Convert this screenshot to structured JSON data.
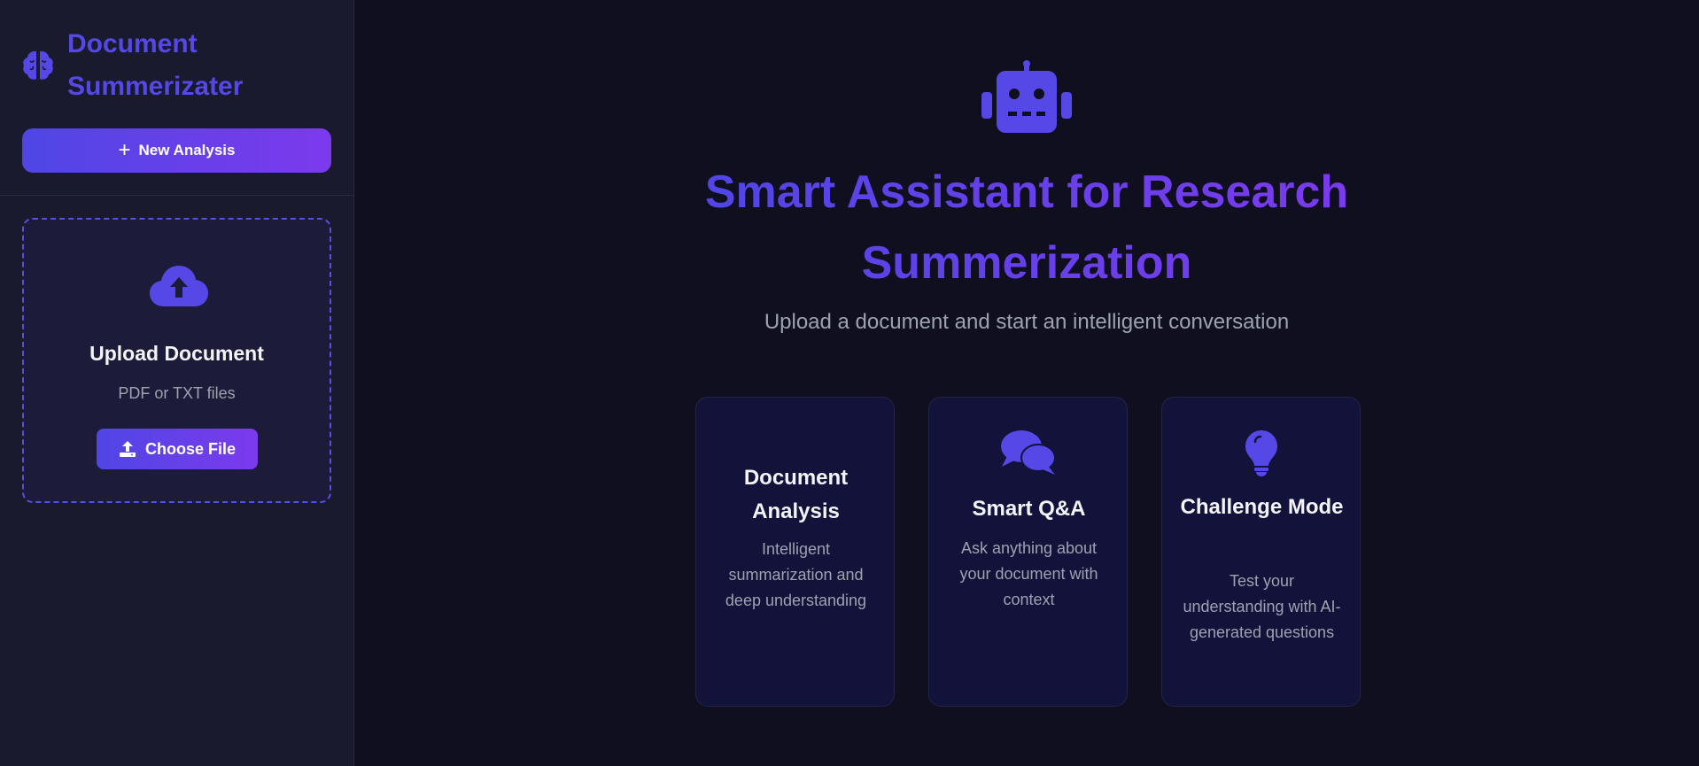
{
  "sidebar": {
    "brand_title": "Document Summerizater",
    "brand_icon": "brain-icon",
    "new_analysis_label": "New Analysis",
    "upload": {
      "icon": "cloud-upload-icon",
      "title": "Upload Document",
      "subtitle": "PDF or TXT files",
      "choose_label": "Choose File"
    }
  },
  "main": {
    "hero_icon": "robot-icon",
    "title": "Smart Assistant for Research Summerization",
    "subtitle": "Upload a document and start an intelligent conversation",
    "cards": [
      {
        "title": "Document Analysis",
        "description": "Intelligent summarization and deep understanding"
      },
      {
        "title": "Smart Q&A",
        "description": "Ask anything about your document with context",
        "icon": "chat-bubbles-icon"
      },
      {
        "title": "Challenge Mode",
        "description": "Test your understanding with AI-generated questions",
        "icon": "lightbulb-icon"
      }
    ]
  },
  "colors": {
    "accent": "#4f46e5",
    "accent_2": "#7c3aed",
    "background": "#0f0f1f",
    "sidebar": "#1a1a2e"
  }
}
